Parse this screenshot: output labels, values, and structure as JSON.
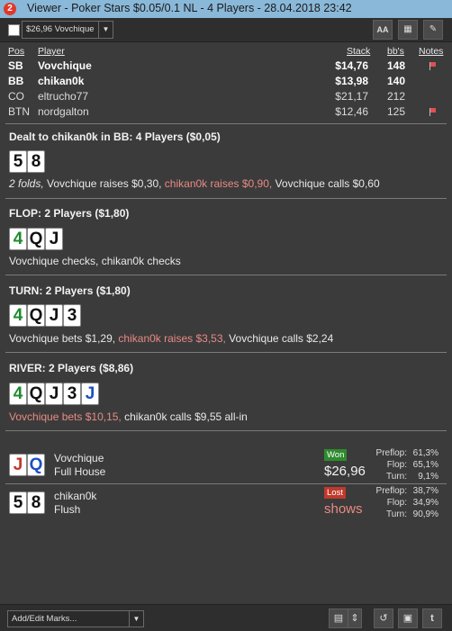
{
  "window": {
    "logo": "2",
    "title": "Viewer - Poker Stars $0.05/0.1 NL - 4 Players - 28.04.2018 23:42"
  },
  "toolbar": {
    "combo_value": "$26,96 Vovchique",
    "font_btn": "AA",
    "grid_btn": "▦",
    "edit_btn": "✎"
  },
  "players_table": {
    "headers": {
      "pos": "Pos",
      "player": "Player",
      "stack": "Stack",
      "bbs": "bb's",
      "notes": "Notes"
    },
    "rows": [
      {
        "pos": "SB",
        "player": "Vovchique",
        "stack": "$14,76",
        "bbs": "148",
        "bold": true,
        "note_flag": true
      },
      {
        "pos": "BB",
        "player": "chikan0k",
        "stack": "$13,98",
        "bbs": "140",
        "bold": true,
        "note_flag": false
      },
      {
        "pos": "CO",
        "player": "eltrucho77",
        "stack": "$21,17",
        "bbs": "212",
        "bold": false,
        "note_flag": false
      },
      {
        "pos": "BTN",
        "player": "nordgalton",
        "stack": "$12,46",
        "bbs": "125",
        "bold": false,
        "note_flag": true
      }
    ]
  },
  "preflop": {
    "header": "Dealt to chikan0k in BB: 4 Players ($0,05)",
    "cards": [
      {
        "rank": "5",
        "suit": "spade"
      },
      {
        "rank": "8",
        "suit": "spade"
      }
    ],
    "action_italic": "2 folds,",
    "action_1": " Vovchique raises $0,30,",
    "action_2": " chikan0k raises $0,90,",
    "action_3": " Vovchique calls $0,60"
  },
  "flop": {
    "header": "FLOP: 2 Players ($1,80)",
    "cards": [
      {
        "rank": "4",
        "suit": "club"
      },
      {
        "rank": "Q",
        "suit": "spade"
      },
      {
        "rank": "J",
        "suit": "spade"
      }
    ],
    "action": "Vovchique checks, chikan0k checks"
  },
  "turn": {
    "header": "TURN: 2 Players ($1,80)",
    "cards": [
      {
        "rank": "4",
        "suit": "club"
      },
      {
        "rank": "Q",
        "suit": "spade"
      },
      {
        "rank": "J",
        "suit": "spade"
      },
      {
        "rank": "3",
        "suit": "spade"
      }
    ],
    "action_1": "Vovchique bets $1,29,",
    "action_2": " chikan0k raises $3,53,",
    "action_3": " Vovchique calls $2,24"
  },
  "river": {
    "header": "RIVER: 2 Players ($8,86)",
    "cards": [
      {
        "rank": "4",
        "suit": "club"
      },
      {
        "rank": "Q",
        "suit": "spade"
      },
      {
        "rank": "J",
        "suit": "spade"
      },
      {
        "rank": "3",
        "suit": "spade"
      },
      {
        "rank": "J",
        "suit": "diamond"
      }
    ],
    "action_1": "Vovchique bets $10,15,",
    "action_2": " chikan0k calls $9,55 all-in"
  },
  "showdown": [
    {
      "player": "Vovchique",
      "hand": "Full House",
      "cards": [
        {
          "rank": "J",
          "suit": "heart"
        },
        {
          "rank": "Q",
          "suit": "diamond"
        }
      ],
      "badge": "Won",
      "badge_color": "#2e8b2e",
      "amount": "$26,96",
      "stats": [
        {
          "label": "Preflop:",
          "value": "61,3%"
        },
        {
          "label": "Flop:",
          "value": "65,1%"
        },
        {
          "label": "Turn:",
          "value": "9,1%"
        }
      ]
    },
    {
      "player": "chikan0k",
      "hand": "Flush",
      "cards": [
        {
          "rank": "5",
          "suit": "spade"
        },
        {
          "rank": "8",
          "suit": "spade"
        }
      ],
      "badge": "Lost",
      "badge_color": "#c0392b",
      "amount": "shows",
      "stats": [
        {
          "label": "Preflop:",
          "value": "38,7%"
        },
        {
          "label": "Flop:",
          "value": "34,9%"
        },
        {
          "label": "Turn:",
          "value": "90,9%"
        }
      ]
    }
  ],
  "bottom": {
    "marks_value": "Add/Edit Marks...",
    "notes_btn": "▤",
    "updown_btn": "⇕",
    "replay_btn": "↺",
    "save_btn": "▣",
    "twitter_btn": "t"
  },
  "colors": {
    "spade": "#111111",
    "club": "#1f8b2e",
    "heart": "#c0392b",
    "diamond": "#1e4fc2",
    "highlight": "#e88a84"
  }
}
